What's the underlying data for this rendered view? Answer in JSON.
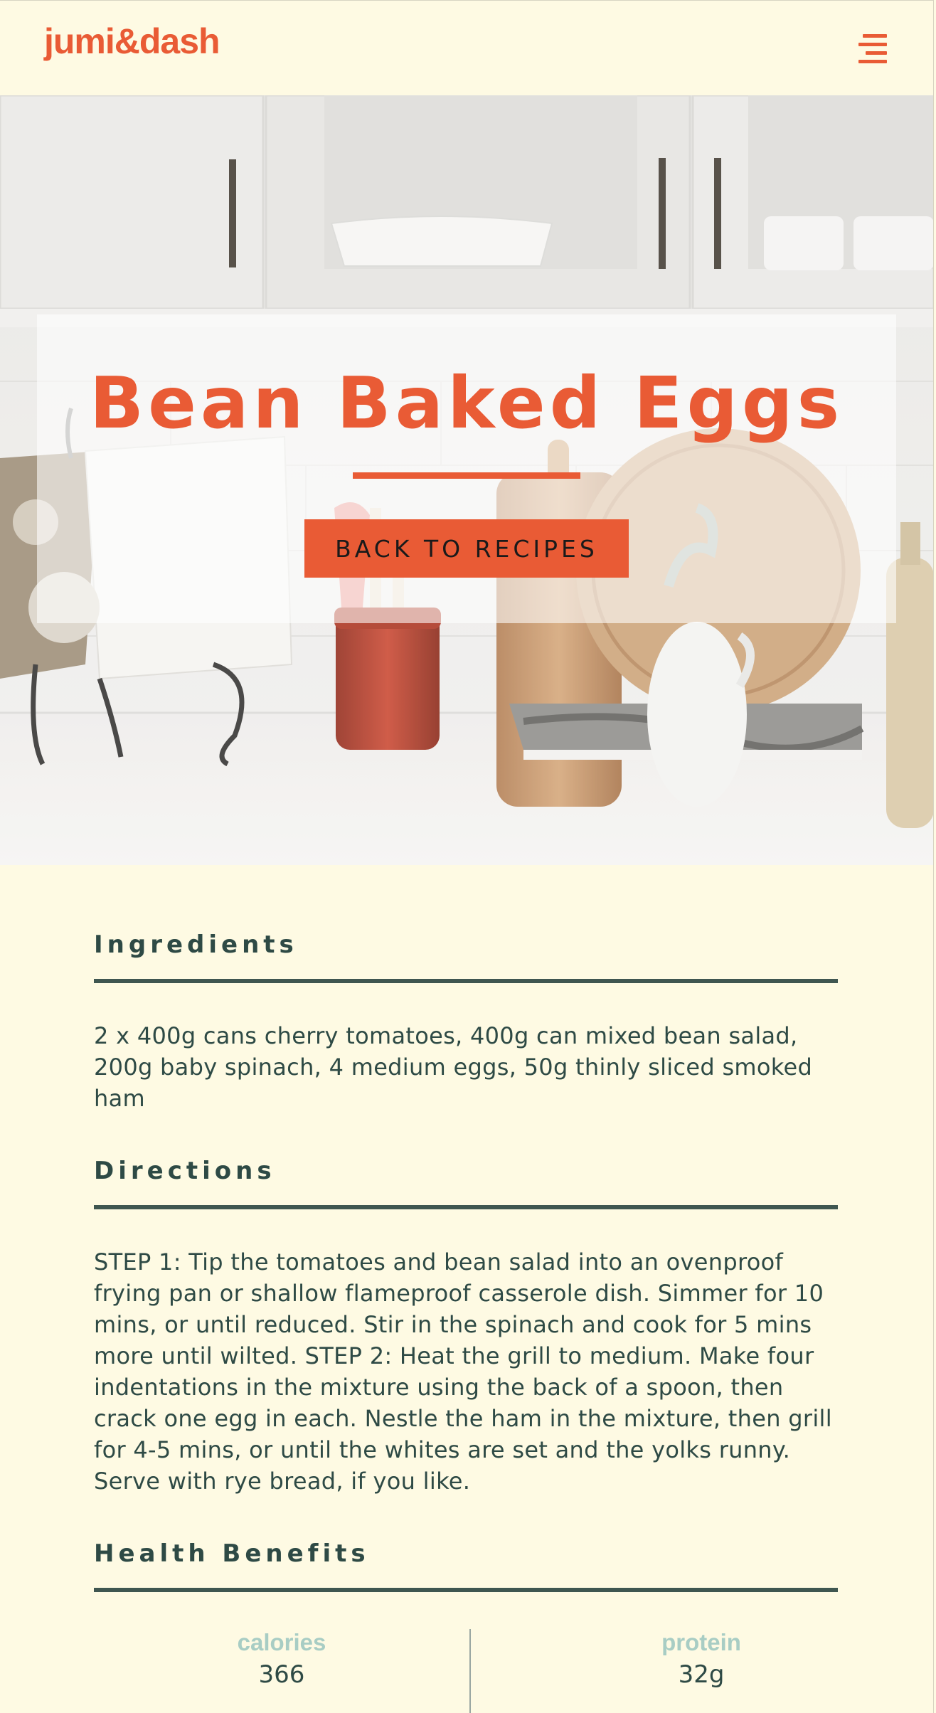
{
  "header": {
    "logo": "jumi&dash",
    "menu_icon": "hamburger-menu-icon"
  },
  "hero": {
    "title": "Bean Baked Eggs",
    "back_button": "BACK TO RECIPES"
  },
  "sections": {
    "ingredients": {
      "heading": "Ingredients",
      "text": "2 x 400g cans cherry tomatoes, 400g can mixed bean salad, 200g baby spinach, 4 medium eggs, 50g thinly sliced smoked ham"
    },
    "directions": {
      "heading": "Directions",
      "text": "STEP 1: Tip the tomatoes and bean salad into an ovenproof frying pan or shallow flameproof casserole dish. Simmer for 10 mins, or until reduced. Stir in the spinach and cook for 5 mins more until wilted. STEP 2: Heat the grill to medium. Make four indentations in the mixture using the back of a spoon, then crack one egg in each. Nestle the ham in the mixture, then grill for 4-5 mins, or until the whites are set and the yolks runny. Serve with rye bread, if you like."
    },
    "health": {
      "heading": "Health Benefits",
      "stats": [
        {
          "label": "calories",
          "value": "366"
        },
        {
          "label": "protein",
          "value": "32g"
        }
      ]
    }
  },
  "colors": {
    "accent": "#e95b35",
    "background": "#fefae3",
    "text": "#2e4a45",
    "stat_label": "#a8cdc4"
  }
}
